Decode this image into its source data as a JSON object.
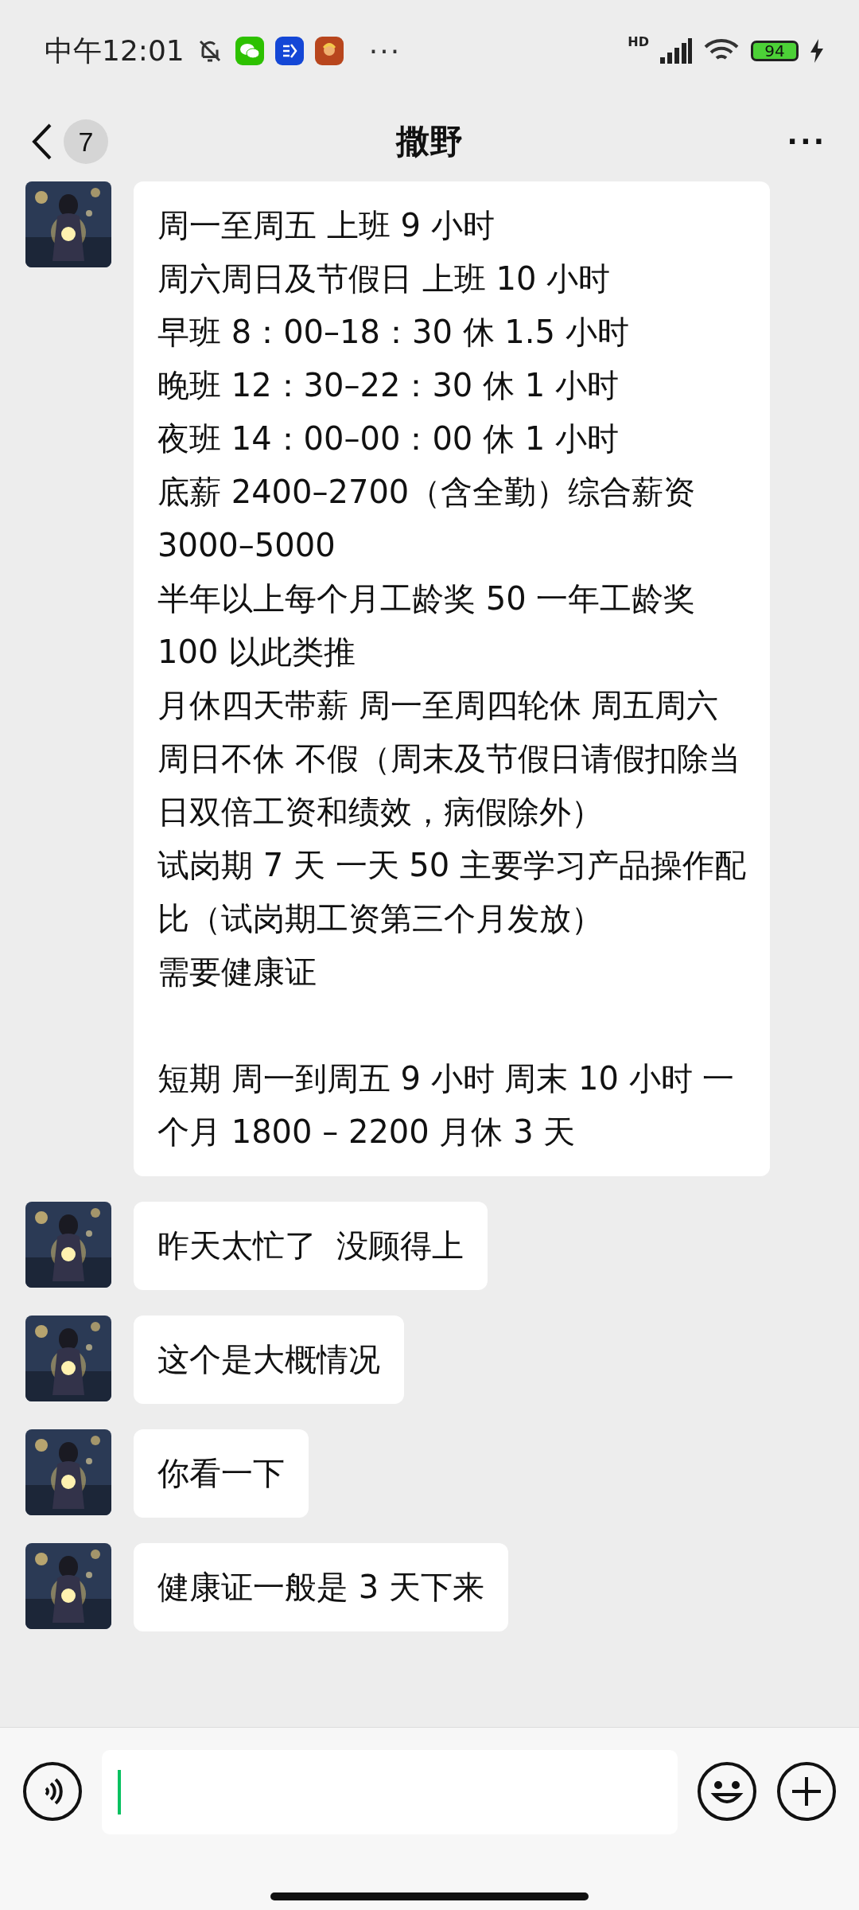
{
  "status_bar": {
    "time": "中午12:01",
    "more": "···",
    "network": "HD",
    "battery": "94"
  },
  "header": {
    "back_count": "7",
    "title": "撒野",
    "more": "···"
  },
  "messages": [
    {
      "lines": [
        "周一至周五 上班 9 小时",
        "周六周日及节假日 上班 10 小时",
        "早班 8：00–18：30 休 1.5 小时",
        "晚班 12：30–22：30 休 1 小时",
        "夜班 14：00–00：00 休 1 小时",
        "底薪 2400–2700（含全勤）综合薪资 3000–5000",
        "半年以上每个月工龄奖 50 一年工龄奖 100 以此类推",
        "月休四天带薪 周一至周四轮休 周五周六周日不休 不假（周末及节假日请假扣除当日双倍工资和绩效，病假除外）",
        "试岗期 7 天 一天 50 主要学习产品操作配比（试岗期工资第三个月发放）",
        "需要健康证",
        "短期 周一到周五 9 小时 周末 10 小时 一个月 1800 – 2200 月休 3 天"
      ]
    },
    {
      "text": "昨天太忙了  没顾得上"
    },
    {
      "text": "这个是大概情况"
    },
    {
      "text": "你看一下"
    },
    {
      "text": "健康证一般是 3 天下来"
    }
  ]
}
